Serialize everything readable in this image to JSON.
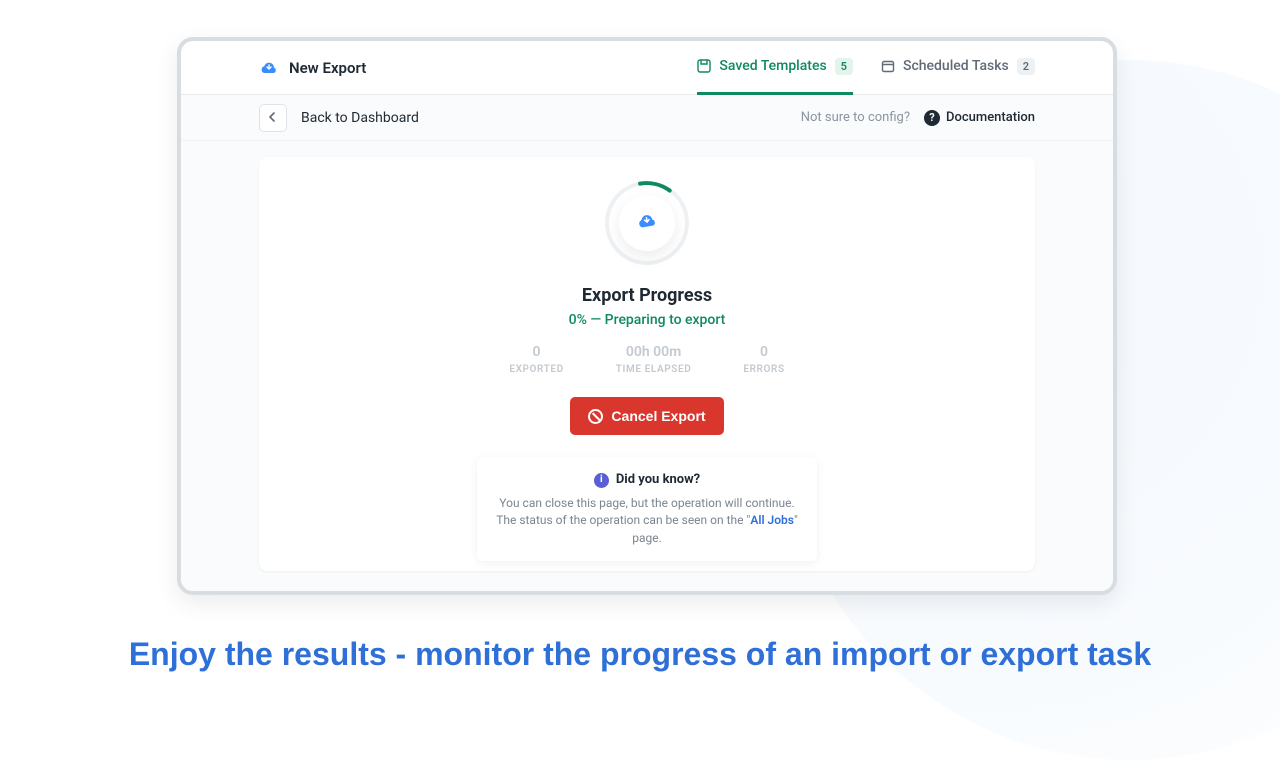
{
  "brand": {
    "title": "New Export"
  },
  "tabs": {
    "saved": {
      "label": "Saved Templates",
      "count": "5"
    },
    "scheduled": {
      "label": "Scheduled Tasks",
      "count": "2"
    }
  },
  "secbar": {
    "back_label": "Back to Dashboard",
    "hint": "Not sure to config?",
    "doc_label": "Documentation"
  },
  "progress": {
    "title": "Export Progress",
    "status": "0% — Preparing to export",
    "stats": {
      "exported": {
        "value": "0",
        "label": "EXPORTED"
      },
      "elapsed": {
        "value": "00h 00m",
        "label": "TIME ELAPSED"
      },
      "errors": {
        "value": "0",
        "label": "ERRORS"
      }
    },
    "cancel_label": "Cancel Export"
  },
  "tip": {
    "heading": "Did you know?",
    "line1": "You can close this page, but the operation will continue.",
    "line2a": "The status of the operation can be seen on the ",
    "link": "All Jobs",
    "line2b": " page."
  },
  "marketing": "Enjoy the results - monitor the progress of an import or export task"
}
